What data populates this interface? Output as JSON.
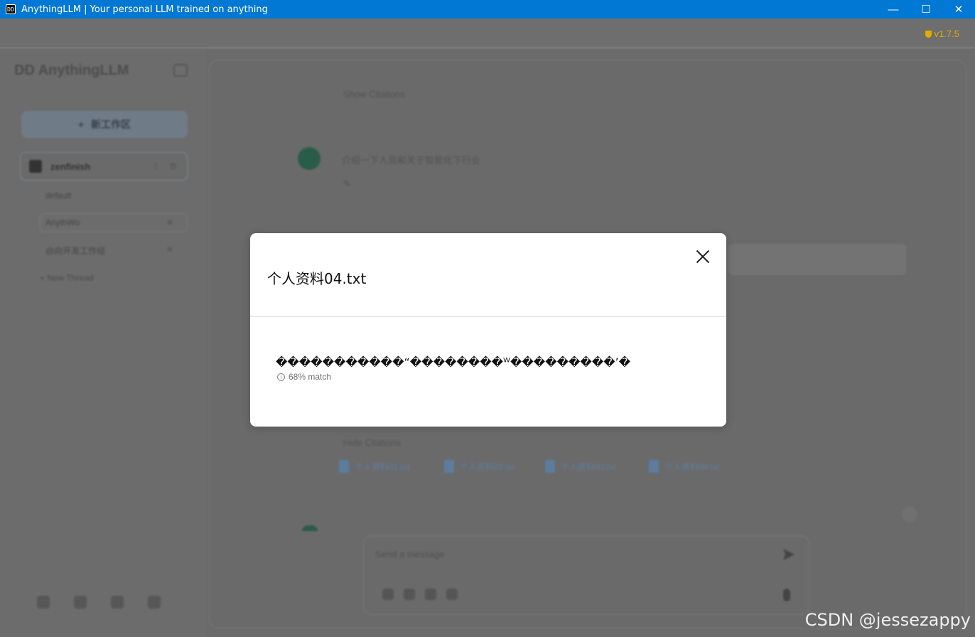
{
  "window": {
    "title": "AnythingLLM | Your personal LLM trained on anything",
    "app_icon_glyph": "DD",
    "controls": {
      "minimize": "—",
      "maximize": "☐",
      "close": "✕"
    }
  },
  "header": {
    "version": "v1.7.5"
  },
  "colors": {
    "titlebar": "#0078d4",
    "accent_version": "#e0ad00",
    "modal_bg": "#ffffff",
    "overlay": "#6b6b6b"
  },
  "sidebar": {
    "brand": "DD AnythingLLM",
    "new_workspace_label": "新工作区",
    "workspace": {
      "name": "zenfinish"
    },
    "threads": [
      {
        "label": "default"
      },
      {
        "label": "AnythWo"
      },
      {
        "label": "@向开发工作组"
      }
    ],
    "new_thread_label": "New Thread",
    "footer_icons": [
      "analytics-icon",
      "chat-icon",
      "community-icon",
      "settings-icon"
    ]
  },
  "main": {
    "show_citations_label": "Show Citations",
    "user_message": "介绍一下人员和关于智能化下行业",
    "hide_citations_label": "Hide Citations",
    "citations": [
      "个人资料01.txt",
      "个人资料02.txt",
      "个人资料03.txt",
      "个人资料04.txt"
    ],
    "composer_placeholder": "Send a message"
  },
  "modal": {
    "title": "个人资料04.txt",
    "chunk_text": "�����������“��������ᵂ���������’�",
    "match_label": "68% match",
    "info_glyph": "i"
  },
  "watermark": "CSDN @jessezappy"
}
